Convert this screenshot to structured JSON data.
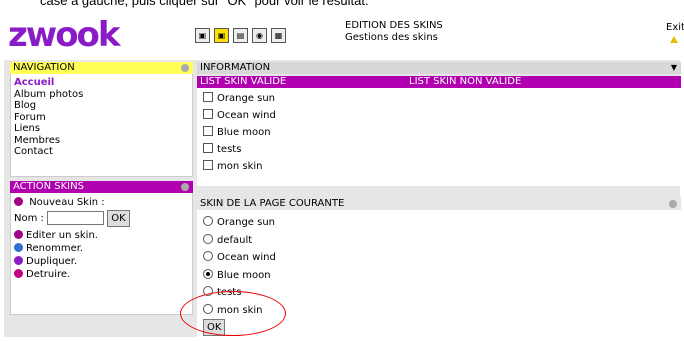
{
  "top_caption": "case à gauche, puis cliquer sur \"OK\" pour voir le résultat.",
  "header": {
    "logo": "zwook",
    "title": "EDITION DES SKINS",
    "subtitle": "Gestions des skins",
    "exit_label": "Exit",
    "tools": [
      "tool-icon-1",
      "tool-icon-2",
      "tool-icon-3",
      "tool-icon-4",
      "tool-icon-5"
    ]
  },
  "navigation": {
    "title": "NAVIGATION",
    "items": [
      "Accueil",
      "Album photos",
      "Blog",
      "Forum",
      "Liens",
      "Membres",
      "Contact"
    ]
  },
  "actions": {
    "title": "ACTION SKINS",
    "new_skin_label": "Nouveau Skin :",
    "nom_label": "Nom :",
    "ok_label": "OK",
    "items": [
      "Editer un skin.",
      "Renommer.",
      "Dupliquer.",
      "Detruire."
    ]
  },
  "information": {
    "title": "INFORMATION",
    "col_valid": "LIST SKIN VALIDE",
    "col_invalid": "LIST SKIN NON VALIDE",
    "skins": [
      "Orange sun",
      "Ocean wind",
      "Blue moon",
      "tests",
      "mon skin"
    ]
  },
  "current_page": {
    "title": "SKIN DE LA PAGE COURANTE",
    "options": [
      "Orange sun",
      "default",
      "Ocean wind",
      "Blue moon",
      "tests",
      "mon skin"
    ],
    "selected": "Blue moon",
    "ok_label": "OK"
  },
  "colors": {
    "accent": "#b000b0",
    "logo": "#8a1cc8",
    "nav_bar": "#ffff55"
  }
}
